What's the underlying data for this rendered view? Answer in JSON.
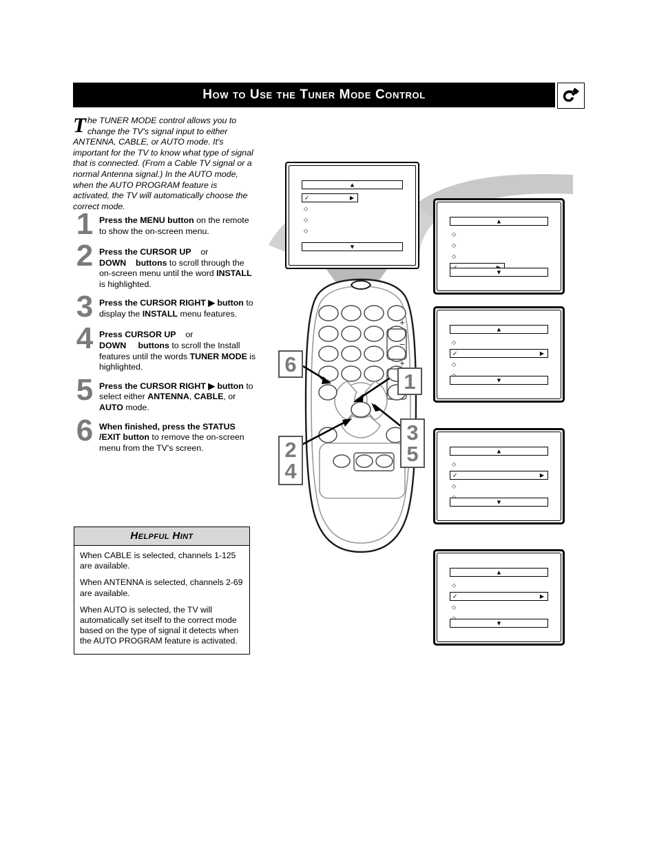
{
  "header": {
    "title": "How to Use the Tuner Mode Control",
    "icon": "remote-hook-icon"
  },
  "intro": {
    "dropcap": "T",
    "text": "he TUNER MODE control allows you to change the TV's signal input to either ANTENNA, CABLE, or AUTO mode. It's important for the TV to know what type of signal that is connected. (From a Cable TV signal or a normal Antenna signal.) In the AUTO mode, when the AUTO PROGRAM feature is activated, the TV will automatically choose the correct mode."
  },
  "steps": [
    {
      "number": "1",
      "parts": [
        {
          "text": "Press the MENU button",
          "bold": true
        },
        {
          "text": " on the remote to show the on-screen menu.",
          "bold": false
        }
      ]
    },
    {
      "number": "2",
      "parts": [
        {
          "text": "Press the CURSOR UP",
          "bold": true
        },
        {
          "text": "    or ",
          "bold": false
        },
        {
          "text": "DOWN",
          "bold": true
        },
        {
          "text": "    ",
          "bold": false
        },
        {
          "text": "buttons",
          "bold": true
        },
        {
          "text": " to scroll through the on-screen menu until the word ",
          "bold": false
        },
        {
          "text": "INSTALL",
          "bold": true
        },
        {
          "text": " is highlighted.",
          "bold": false
        }
      ]
    },
    {
      "number": "3",
      "parts": [
        {
          "text": "Press the CURSOR RIGHT ▶",
          "bold": true
        },
        {
          "text": " ",
          "bold": false
        },
        {
          "text": "button",
          "bold": true
        },
        {
          "text": " to display the ",
          "bold": false
        },
        {
          "text": "INSTALL",
          "bold": true
        },
        {
          "text": " menu features.",
          "bold": false
        }
      ]
    },
    {
      "number": "4",
      "parts": [
        {
          "text": "Press CURSOR UP",
          "bold": true
        },
        {
          "text": "    or ",
          "bold": false
        },
        {
          "text": "DOWN",
          "bold": true
        },
        {
          "text": "     ",
          "bold": false
        },
        {
          "text": "buttons",
          "bold": true
        },
        {
          "text": " to scroll the Install features until the words ",
          "bold": false
        },
        {
          "text": "TUNER MODE",
          "bold": true
        },
        {
          "text": " is highlighted.",
          "bold": false
        }
      ]
    },
    {
      "number": "5",
      "parts": [
        {
          "text": "Press the CURSOR RIGHT ▶",
          "bold": true
        },
        {
          "text": " ",
          "bold": false
        },
        {
          "text": "button",
          "bold": true
        },
        {
          "text": " to select either ",
          "bold": false
        },
        {
          "text": "ANTENNA",
          "bold": true
        },
        {
          "text": ", ",
          "bold": false
        },
        {
          "text": "CABLE",
          "bold": true
        },
        {
          "text": ", or ",
          "bold": false
        },
        {
          "text": "AUTO",
          "bold": true
        },
        {
          "text": " mode.",
          "bold": false
        }
      ]
    },
    {
      "number": "6",
      "parts": [
        {
          "text": "When finished, press the STATUS /EXIT button",
          "bold": true
        },
        {
          "text": " to remove the on-screen menu from the TV's screen.",
          "bold": false
        }
      ]
    }
  ],
  "hint": {
    "title": "Helpful Hint",
    "paragraphs": [
      "When CABLE is selected, channels 1-125 are available.",
      "When ANTENNA is selected, channels 2-69 are available.",
      "When AUTO is selected, the TV will automatically set itself to the correct mode based on the type of signal it detects when the AUTO PROGRAM feature is activated."
    ]
  },
  "tv_screen": {
    "name": "on-screen-menu",
    "up_arrow": "▲",
    "down_arrow": "▼",
    "check": "✓",
    "right_arrow": "▶",
    "bullet": "◇",
    "highlight_index": 1,
    "highlight_width": "half",
    "rows": 4
  },
  "panels": [
    {
      "name": "menu-panel-1",
      "highlight_index": 4,
      "highlight_width": "half",
      "rows": 4,
      "up_arrow": "▲",
      "down_arrow": "▼",
      "check": "✓",
      "right_arrow": "▶",
      "bullet": "◇"
    },
    {
      "name": "menu-panel-2",
      "highlight_index": 2,
      "highlight_width": "full",
      "rows": 4,
      "up_arrow": "▲",
      "down_arrow": "▼",
      "check": "✓",
      "right_arrow": "▶",
      "bullet": "◇"
    },
    {
      "name": "menu-panel-3",
      "highlight_index": 2,
      "highlight_width": "full",
      "rows": 4,
      "up_arrow": "▲",
      "down_arrow": "▼",
      "check": "✓",
      "right_arrow": "▶",
      "bullet": "◇"
    },
    {
      "name": "menu-panel-4",
      "highlight_index": 2,
      "highlight_width": "full",
      "rows": 4,
      "up_arrow": "▲",
      "down_arrow": "▼",
      "check": "✓",
      "right_arrow": "▶",
      "bullet": "◇"
    }
  ],
  "callouts": [
    {
      "name": "callout-6",
      "labels": [
        "6"
      ]
    },
    {
      "name": "callout-1",
      "labels": [
        "1"
      ]
    },
    {
      "name": "callout-3-5",
      "labels": [
        "3",
        "5"
      ]
    },
    {
      "name": "callout-2-4",
      "labels": [
        "2",
        "4"
      ]
    }
  ],
  "remote": {
    "name": "remote-control-illustration",
    "plus": "+",
    "minus": "–"
  },
  "colors": {
    "header_bg": "#000000",
    "header_text": "#ffffff",
    "step_number": "#7b7b7b",
    "hint_header_bg": "#d8d8d8",
    "connector_grey": "#c8c8c8",
    "callout_border": "#555555"
  }
}
